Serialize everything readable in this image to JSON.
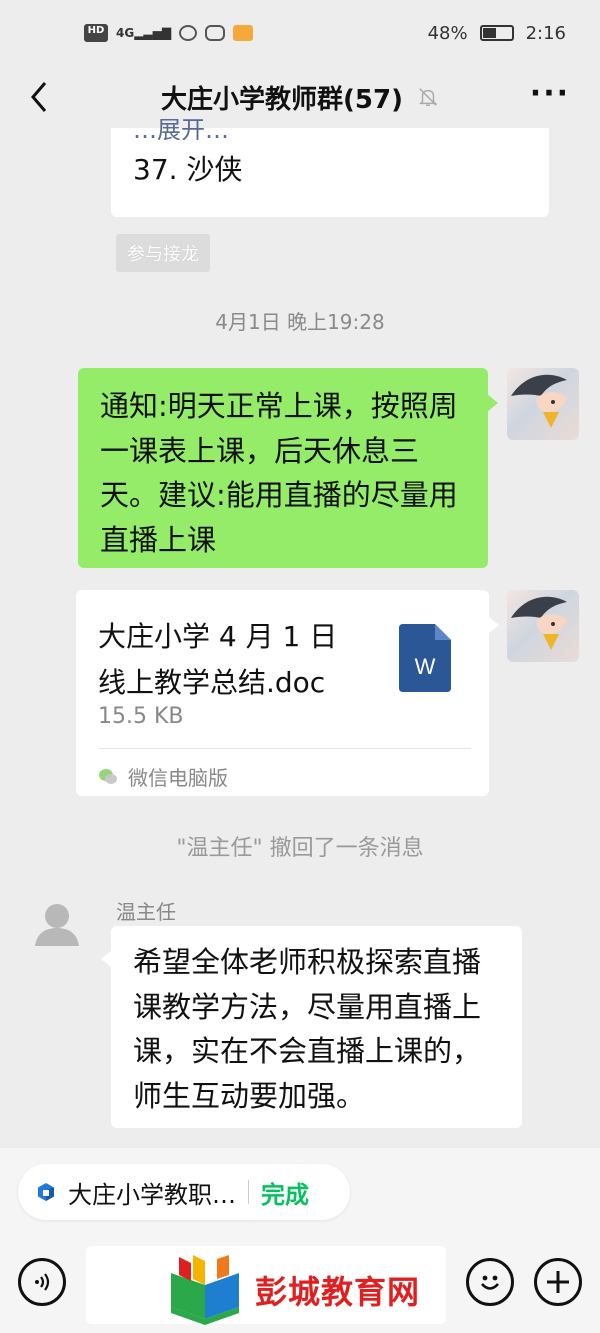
{
  "status_bar": {
    "network_label": "HD",
    "signal_label": "4G",
    "battery": "48%",
    "battery_level": 0.48,
    "time": "2:16"
  },
  "header": {
    "title": "大庄小学教师群(57)",
    "muted": true
  },
  "jielong": {
    "expand_text": "…展开…",
    "last_entry": "37. 沙侠",
    "join_label": "参与接龙"
  },
  "timestamp": "4月1日 晚上19:28",
  "messages": [
    {
      "sender": "me",
      "type": "text",
      "text": "通知:明天正常上课，按照周一课表上课，后天休息三天。建议:能用直播的尽量用直播上课"
    },
    {
      "sender": "me",
      "type": "file",
      "file_name_line1": "大庄小学 4 月 1 日",
      "file_name_line2": "线上教学总结.doc",
      "file_size": "15.5 KB",
      "file_icon_letter": "W",
      "source": "微信电脑版"
    }
  ],
  "recall_note": "\"温主任\" 撤回了一条消息",
  "other_message": {
    "sender_name": "温主任",
    "text": "希望全体老师积极探索直播课教学方法，尽量用直播上课，实在不会直播上课的，师生互动要加强。"
  },
  "pending_bar": {
    "label": "大庄小学教职…",
    "action": "完成"
  },
  "watermark": {
    "text": "彭城教育网"
  },
  "colors": {
    "background": "#ededed",
    "bubble_green": "#95ec69",
    "link_blue": "#576b95",
    "accent_green": "#07c160",
    "word_blue": "#2b5797",
    "watermark_red": "#e02020"
  }
}
